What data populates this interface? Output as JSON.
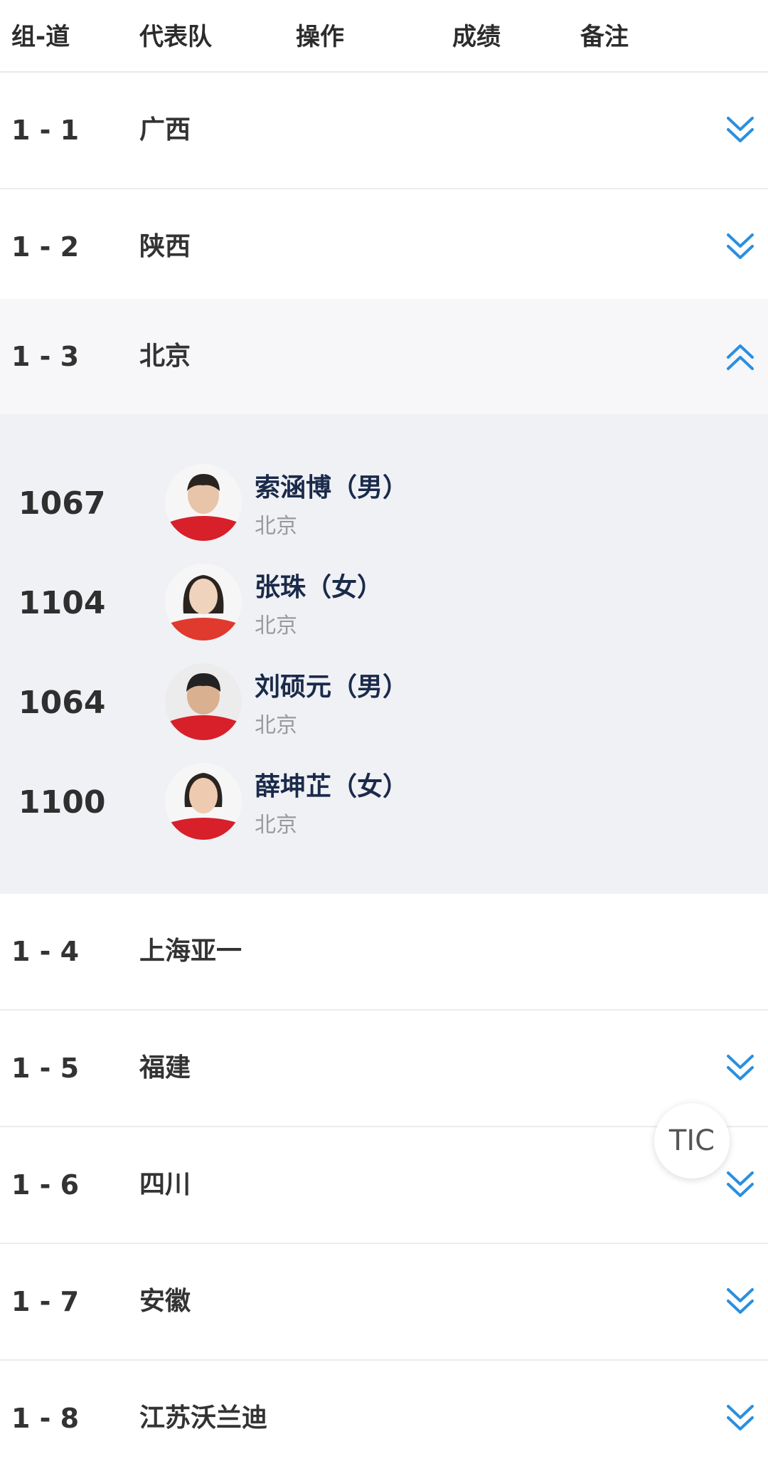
{
  "header": {
    "col_lane": "组-道",
    "col_team": "代表队",
    "col_action": "操作",
    "col_score": "成绩",
    "col_note": "备注"
  },
  "rows": [
    {
      "lane": "1 - 1",
      "team": "广西",
      "state": "collapsed"
    },
    {
      "lane": "1 - 2",
      "team": "陕西",
      "state": "collapsed"
    },
    {
      "lane": "1 - 3",
      "team": "北京",
      "state": "expanded"
    },
    {
      "lane": "1 - 4",
      "team": "上海亚一",
      "state": "none"
    },
    {
      "lane": "1 - 5",
      "team": "福建",
      "state": "collapsed"
    },
    {
      "lane": "1 - 6",
      "team": "四川",
      "state": "collapsed"
    },
    {
      "lane": "1 - 7",
      "team": "安徽",
      "state": "collapsed"
    },
    {
      "lane": "1 - 8",
      "team": "江苏沃兰迪",
      "state": "collapsed"
    }
  ],
  "athletes": [
    {
      "bib": "1067",
      "name": "索涵博（男）",
      "team": "北京"
    },
    {
      "bib": "1104",
      "name": "张珠（女）",
      "team": "北京"
    },
    {
      "bib": "1064",
      "name": "刘硕元（男）",
      "team": "北京"
    },
    {
      "bib": "1100",
      "name": "薛坤芷（女）",
      "team": "北京"
    }
  ],
  "float_button": {
    "label": "TIC"
  },
  "colors": {
    "accent_chevron": "#2a8fe0",
    "jersey_red": "#d7202a",
    "name_text": "#1a2a4a"
  }
}
